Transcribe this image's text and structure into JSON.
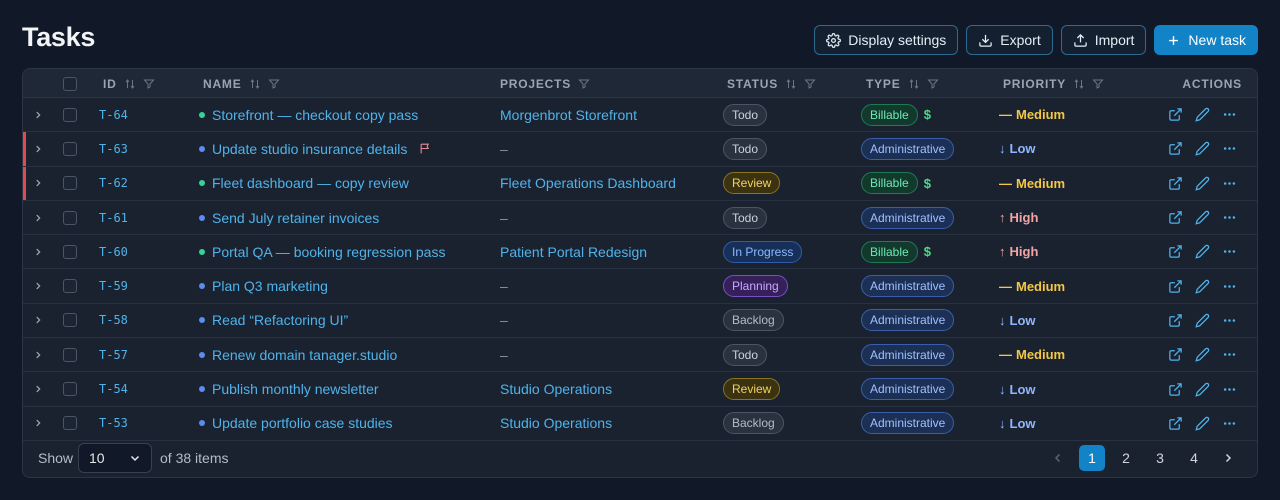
{
  "page": {
    "title": "Tasks"
  },
  "toolbar": {
    "display_settings": "Display settings",
    "export": "Export",
    "import": "Import",
    "new_task": "New task"
  },
  "columns": {
    "id": "ID",
    "name": "NAME",
    "projects": "PROJECTS",
    "status": "STATUS",
    "type": "TYPE",
    "priority": "PRIORITY",
    "actions": "ACTIONS"
  },
  "colors": {
    "accent": "#1283c7",
    "link": "#4fb3ea",
    "flag_bar": "#e5484d"
  },
  "rows": [
    {
      "id": "T-64",
      "name": "Storefront — checkout copy pass",
      "dot": "#34d399",
      "flag": false,
      "flagged": false,
      "project": "Morgenbrot Storefront",
      "status": "Todo",
      "type": "Billable",
      "billable": true,
      "priority_icon": "—",
      "priority": "Medium"
    },
    {
      "id": "T-63",
      "name": "Update studio insurance details",
      "dot": "#5b8def",
      "flag": true,
      "flagged": true,
      "project": "–",
      "status": "Todo",
      "type": "Administrative",
      "billable": false,
      "priority_icon": "↓",
      "priority": "Low"
    },
    {
      "id": "T-62",
      "name": "Fleet dashboard — copy review",
      "dot": "#34d399",
      "flag": false,
      "flagged": true,
      "project": "Fleet Operations Dashboard",
      "status": "Review",
      "type": "Billable",
      "billable": true,
      "priority_icon": "—",
      "priority": "Medium"
    },
    {
      "id": "T-61",
      "name": "Send July retainer invoices",
      "dot": "#5b8def",
      "flag": false,
      "flagged": false,
      "project": "–",
      "status": "Todo",
      "type": "Administrative",
      "billable": false,
      "priority_icon": "↑",
      "priority": "High"
    },
    {
      "id": "T-60",
      "name": "Portal QA — booking regression pass",
      "dot": "#34d399",
      "flag": false,
      "flagged": false,
      "project": "Patient Portal Redesign",
      "status": "In Progress",
      "type": "Billable",
      "billable": true,
      "priority_icon": "↑",
      "priority": "High"
    },
    {
      "id": "T-59",
      "name": "Plan Q3 marketing",
      "dot": "#5b8def",
      "flag": false,
      "flagged": false,
      "project": "–",
      "status": "Planning",
      "type": "Administrative",
      "billable": false,
      "priority_icon": "—",
      "priority": "Medium"
    },
    {
      "id": "T-58",
      "name": "Read “Refactoring UI”",
      "dot": "#5b8def",
      "flag": false,
      "flagged": false,
      "project": "–",
      "status": "Backlog",
      "type": "Administrative",
      "billable": false,
      "priority_icon": "↓",
      "priority": "Low"
    },
    {
      "id": "T-57",
      "name": "Renew domain tanager.studio",
      "dot": "#5b8def",
      "flag": false,
      "flagged": false,
      "project": "–",
      "status": "Todo",
      "type": "Administrative",
      "billable": false,
      "priority_icon": "—",
      "priority": "Medium"
    },
    {
      "id": "T-54",
      "name": "Publish monthly newsletter",
      "dot": "#5b8def",
      "flag": false,
      "flagged": false,
      "project": "Studio Operations",
      "status": "Review",
      "type": "Administrative",
      "billable": false,
      "priority_icon": "↓",
      "priority": "Low"
    },
    {
      "id": "T-53",
      "name": "Update portfolio case studies",
      "dot": "#5b8def",
      "flag": false,
      "flagged": false,
      "project": "Studio Operations",
      "status": "Backlog",
      "type": "Administrative",
      "billable": false,
      "priority_icon": "↓",
      "priority": "Low"
    }
  ],
  "footer": {
    "show_label": "Show",
    "page_size": "10",
    "item_count": "of 38 items",
    "pages": [
      "1",
      "2",
      "3",
      "4"
    ],
    "current_page": "1"
  }
}
